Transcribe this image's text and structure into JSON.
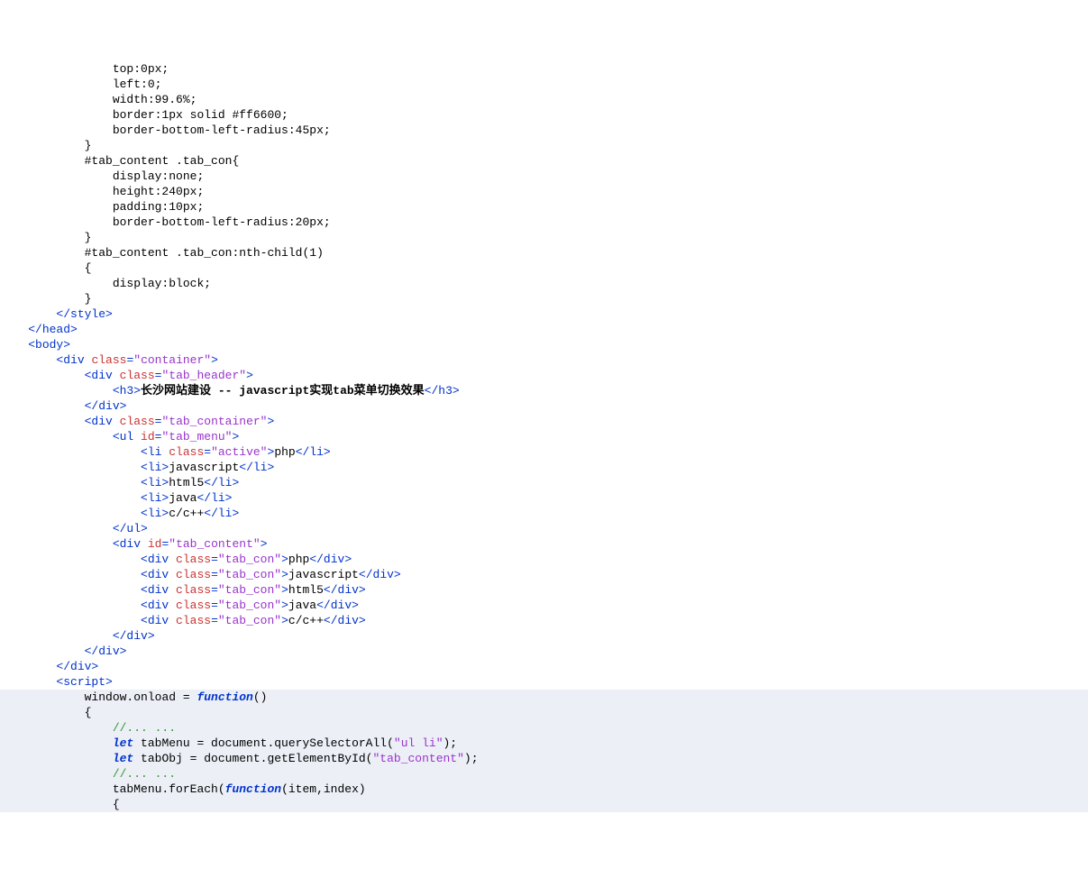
{
  "lines": [
    {
      "indent": 16,
      "tokens": [
        {
          "c": "plain",
          "t": "top:0px;"
        }
      ]
    },
    {
      "indent": 16,
      "tokens": [
        {
          "c": "plain",
          "t": "left:0;"
        }
      ]
    },
    {
      "indent": 16,
      "tokens": [
        {
          "c": "plain",
          "t": "width:99.6%;"
        }
      ]
    },
    {
      "indent": 16,
      "tokens": [
        {
          "c": "plain",
          "t": "border:1px solid #ff6600;"
        }
      ]
    },
    {
      "indent": 16,
      "tokens": [
        {
          "c": "plain",
          "t": "border-bottom-left-radius:45px;"
        }
      ]
    },
    {
      "indent": 12,
      "tokens": [
        {
          "c": "plain",
          "t": "}"
        }
      ]
    },
    {
      "indent": 12,
      "tokens": [
        {
          "c": "plain",
          "t": "#tab_content .tab_con{"
        }
      ]
    },
    {
      "indent": 16,
      "tokens": [
        {
          "c": "plain",
          "t": "display:none;"
        }
      ]
    },
    {
      "indent": 16,
      "tokens": [
        {
          "c": "plain",
          "t": "height:240px;"
        }
      ]
    },
    {
      "indent": 16,
      "tokens": [
        {
          "c": "plain",
          "t": "padding:10px;"
        }
      ]
    },
    {
      "indent": 16,
      "tokens": [
        {
          "c": "plain",
          "t": "border-bottom-left-radius:20px;"
        }
      ]
    },
    {
      "indent": 12,
      "tokens": [
        {
          "c": "plain",
          "t": "}"
        }
      ]
    },
    {
      "indent": 12,
      "tokens": [
        {
          "c": "plain",
          "t": "#tab_content .tab_con:nth-child(1)"
        }
      ]
    },
    {
      "indent": 12,
      "tokens": [
        {
          "c": "plain",
          "t": "{"
        }
      ]
    },
    {
      "indent": 16,
      "tokens": [
        {
          "c": "plain",
          "t": "display:block;"
        }
      ]
    },
    {
      "indent": 12,
      "tokens": [
        {
          "c": "plain",
          "t": "}"
        }
      ]
    },
    {
      "indent": 8,
      "tokens": [
        {
          "c": "tag",
          "t": "</style>"
        }
      ]
    },
    {
      "indent": 4,
      "tokens": [
        {
          "c": "tag",
          "t": "</head>"
        }
      ]
    },
    {
      "indent": 4,
      "tokens": [
        {
          "c": "tag",
          "t": "<body>"
        }
      ]
    },
    {
      "indent": 8,
      "tokens": [
        {
          "c": "tag",
          "t": "<div "
        },
        {
          "c": "attr-name",
          "t": "class"
        },
        {
          "c": "tag",
          "t": "="
        },
        {
          "c": "attr-val",
          "t": "\"container\""
        },
        {
          "c": "tag",
          "t": ">"
        }
      ]
    },
    {
      "indent": 12,
      "tokens": [
        {
          "c": "tag",
          "t": "<div "
        },
        {
          "c": "attr-name",
          "t": "class"
        },
        {
          "c": "tag",
          "t": "="
        },
        {
          "c": "attr-val",
          "t": "\"tab_header\""
        },
        {
          "c": "tag",
          "t": ">"
        }
      ]
    },
    {
      "indent": 16,
      "tokens": [
        {
          "c": "tag",
          "t": "<h3>"
        },
        {
          "c": "bold",
          "t": "长沙网站建设 -- javascript实现tab菜单切换效果"
        },
        {
          "c": "tag",
          "t": "</h3>"
        }
      ]
    },
    {
      "indent": 12,
      "tokens": [
        {
          "c": "tag",
          "t": "</div>"
        }
      ]
    },
    {
      "indent": 12,
      "tokens": [
        {
          "c": "tag",
          "t": "<div "
        },
        {
          "c": "attr-name",
          "t": "class"
        },
        {
          "c": "tag",
          "t": "="
        },
        {
          "c": "attr-val",
          "t": "\"tab_container\""
        },
        {
          "c": "tag",
          "t": ">"
        }
      ]
    },
    {
      "indent": 16,
      "tokens": [
        {
          "c": "tag",
          "t": "<ul "
        },
        {
          "c": "attr-name",
          "t": "id"
        },
        {
          "c": "tag",
          "t": "="
        },
        {
          "c": "attr-val",
          "t": "\"tab_menu\""
        },
        {
          "c": "tag",
          "t": ">"
        }
      ]
    },
    {
      "indent": 20,
      "tokens": [
        {
          "c": "tag",
          "t": "<li "
        },
        {
          "c": "attr-name",
          "t": "class"
        },
        {
          "c": "tag",
          "t": "="
        },
        {
          "c": "attr-val",
          "t": "\"active\""
        },
        {
          "c": "tag",
          "t": ">"
        },
        {
          "c": "plain",
          "t": "php"
        },
        {
          "c": "tag",
          "t": "</li>"
        }
      ]
    },
    {
      "indent": 20,
      "tokens": [
        {
          "c": "tag",
          "t": "<li>"
        },
        {
          "c": "plain",
          "t": "javascript"
        },
        {
          "c": "tag",
          "t": "</li>"
        }
      ]
    },
    {
      "indent": 20,
      "tokens": [
        {
          "c": "tag",
          "t": "<li>"
        },
        {
          "c": "plain",
          "t": "html5"
        },
        {
          "c": "tag",
          "t": "</li>"
        }
      ]
    },
    {
      "indent": 20,
      "tokens": [
        {
          "c": "tag",
          "t": "<li>"
        },
        {
          "c": "plain",
          "t": "java"
        },
        {
          "c": "tag",
          "t": "</li>"
        }
      ]
    },
    {
      "indent": 20,
      "tokens": [
        {
          "c": "tag",
          "t": "<li>"
        },
        {
          "c": "plain",
          "t": "c/c++"
        },
        {
          "c": "tag",
          "t": "</li>"
        }
      ]
    },
    {
      "indent": 16,
      "tokens": [
        {
          "c": "tag",
          "t": "</ul>"
        }
      ]
    },
    {
      "indent": 16,
      "tokens": [
        {
          "c": "tag",
          "t": "<div "
        },
        {
          "c": "attr-name",
          "t": "id"
        },
        {
          "c": "tag",
          "t": "="
        },
        {
          "c": "attr-val",
          "t": "\"tab_content\""
        },
        {
          "c": "tag",
          "t": ">"
        }
      ]
    },
    {
      "indent": 20,
      "tokens": [
        {
          "c": "tag",
          "t": "<div "
        },
        {
          "c": "attr-name",
          "t": "class"
        },
        {
          "c": "tag",
          "t": "="
        },
        {
          "c": "attr-val",
          "t": "\"tab_con\""
        },
        {
          "c": "tag",
          "t": ">"
        },
        {
          "c": "plain",
          "t": "php"
        },
        {
          "c": "tag",
          "t": "</div>"
        }
      ]
    },
    {
      "indent": 20,
      "tokens": [
        {
          "c": "tag",
          "t": "<div "
        },
        {
          "c": "attr-name",
          "t": "class"
        },
        {
          "c": "tag",
          "t": "="
        },
        {
          "c": "attr-val",
          "t": "\"tab_con\""
        },
        {
          "c": "tag",
          "t": ">"
        },
        {
          "c": "plain",
          "t": "javascript"
        },
        {
          "c": "tag",
          "t": "</div>"
        }
      ]
    },
    {
      "indent": 20,
      "tokens": [
        {
          "c": "tag",
          "t": "<div "
        },
        {
          "c": "attr-name",
          "t": "class"
        },
        {
          "c": "tag",
          "t": "="
        },
        {
          "c": "attr-val",
          "t": "\"tab_con\""
        },
        {
          "c": "tag",
          "t": ">"
        },
        {
          "c": "plain",
          "t": "html5"
        },
        {
          "c": "tag",
          "t": "</div>"
        }
      ]
    },
    {
      "indent": 20,
      "tokens": [
        {
          "c": "tag",
          "t": "<div "
        },
        {
          "c": "attr-name",
          "t": "class"
        },
        {
          "c": "tag",
          "t": "="
        },
        {
          "c": "attr-val",
          "t": "\"tab_con\""
        },
        {
          "c": "tag",
          "t": ">"
        },
        {
          "c": "plain",
          "t": "java"
        },
        {
          "c": "tag",
          "t": "</div>"
        }
      ]
    },
    {
      "indent": 20,
      "tokens": [
        {
          "c": "tag",
          "t": "<div "
        },
        {
          "c": "attr-name",
          "t": "class"
        },
        {
          "c": "tag",
          "t": "="
        },
        {
          "c": "attr-val",
          "t": "\"tab_con\""
        },
        {
          "c": "tag",
          "t": ">"
        },
        {
          "c": "plain",
          "t": "c/c++"
        },
        {
          "c": "tag",
          "t": "</div>"
        }
      ]
    },
    {
      "indent": 16,
      "tokens": [
        {
          "c": "tag",
          "t": "</div>"
        }
      ]
    },
    {
      "indent": 12,
      "tokens": [
        {
          "c": "tag",
          "t": "</div>"
        }
      ]
    },
    {
      "indent": 8,
      "tokens": [
        {
          "c": "tag",
          "t": "</div>"
        }
      ]
    },
    {
      "indent": 8,
      "tokens": [
        {
          "c": "tag",
          "t": "<script>"
        }
      ],
      "bgStart": true
    },
    {
      "indent": 12,
      "bg": true,
      "tokens": [
        {
          "c": "plain",
          "t": "window.onload = "
        },
        {
          "c": "keyword",
          "t": "function"
        },
        {
          "c": "plain",
          "t": "()"
        }
      ]
    },
    {
      "indent": 12,
      "bg": true,
      "tokens": [
        {
          "c": "plain",
          "t": "{"
        }
      ]
    },
    {
      "indent": 16,
      "bg": true,
      "tokens": [
        {
          "c": "comment",
          "t": "//... ..."
        }
      ]
    },
    {
      "indent": 16,
      "bg": true,
      "tokens": [
        {
          "c": "keyword",
          "t": "let"
        },
        {
          "c": "plain",
          "t": " tabMenu = document.querySelectorAll("
        },
        {
          "c": "str",
          "t": "\"ul li\""
        },
        {
          "c": "plain",
          "t": ");"
        }
      ]
    },
    {
      "indent": 16,
      "bg": true,
      "tokens": [
        {
          "c": "keyword",
          "t": "let"
        },
        {
          "c": "plain",
          "t": " tabObj = document.getElementById("
        },
        {
          "c": "str",
          "t": "\"tab_content\""
        },
        {
          "c": "plain",
          "t": ");"
        }
      ]
    },
    {
      "indent": 16,
      "bg": true,
      "tokens": [
        {
          "c": "comment",
          "t": "//... ..."
        }
      ]
    },
    {
      "indent": 16,
      "bg": true,
      "tokens": [
        {
          "c": "plain",
          "t": "tabMenu.forEach("
        },
        {
          "c": "keyword",
          "t": "function"
        },
        {
          "c": "plain",
          "t": "(item,index)"
        }
      ]
    },
    {
      "indent": 16,
      "bg": true,
      "tokens": [
        {
          "c": "plain",
          "t": "{"
        }
      ]
    }
  ]
}
